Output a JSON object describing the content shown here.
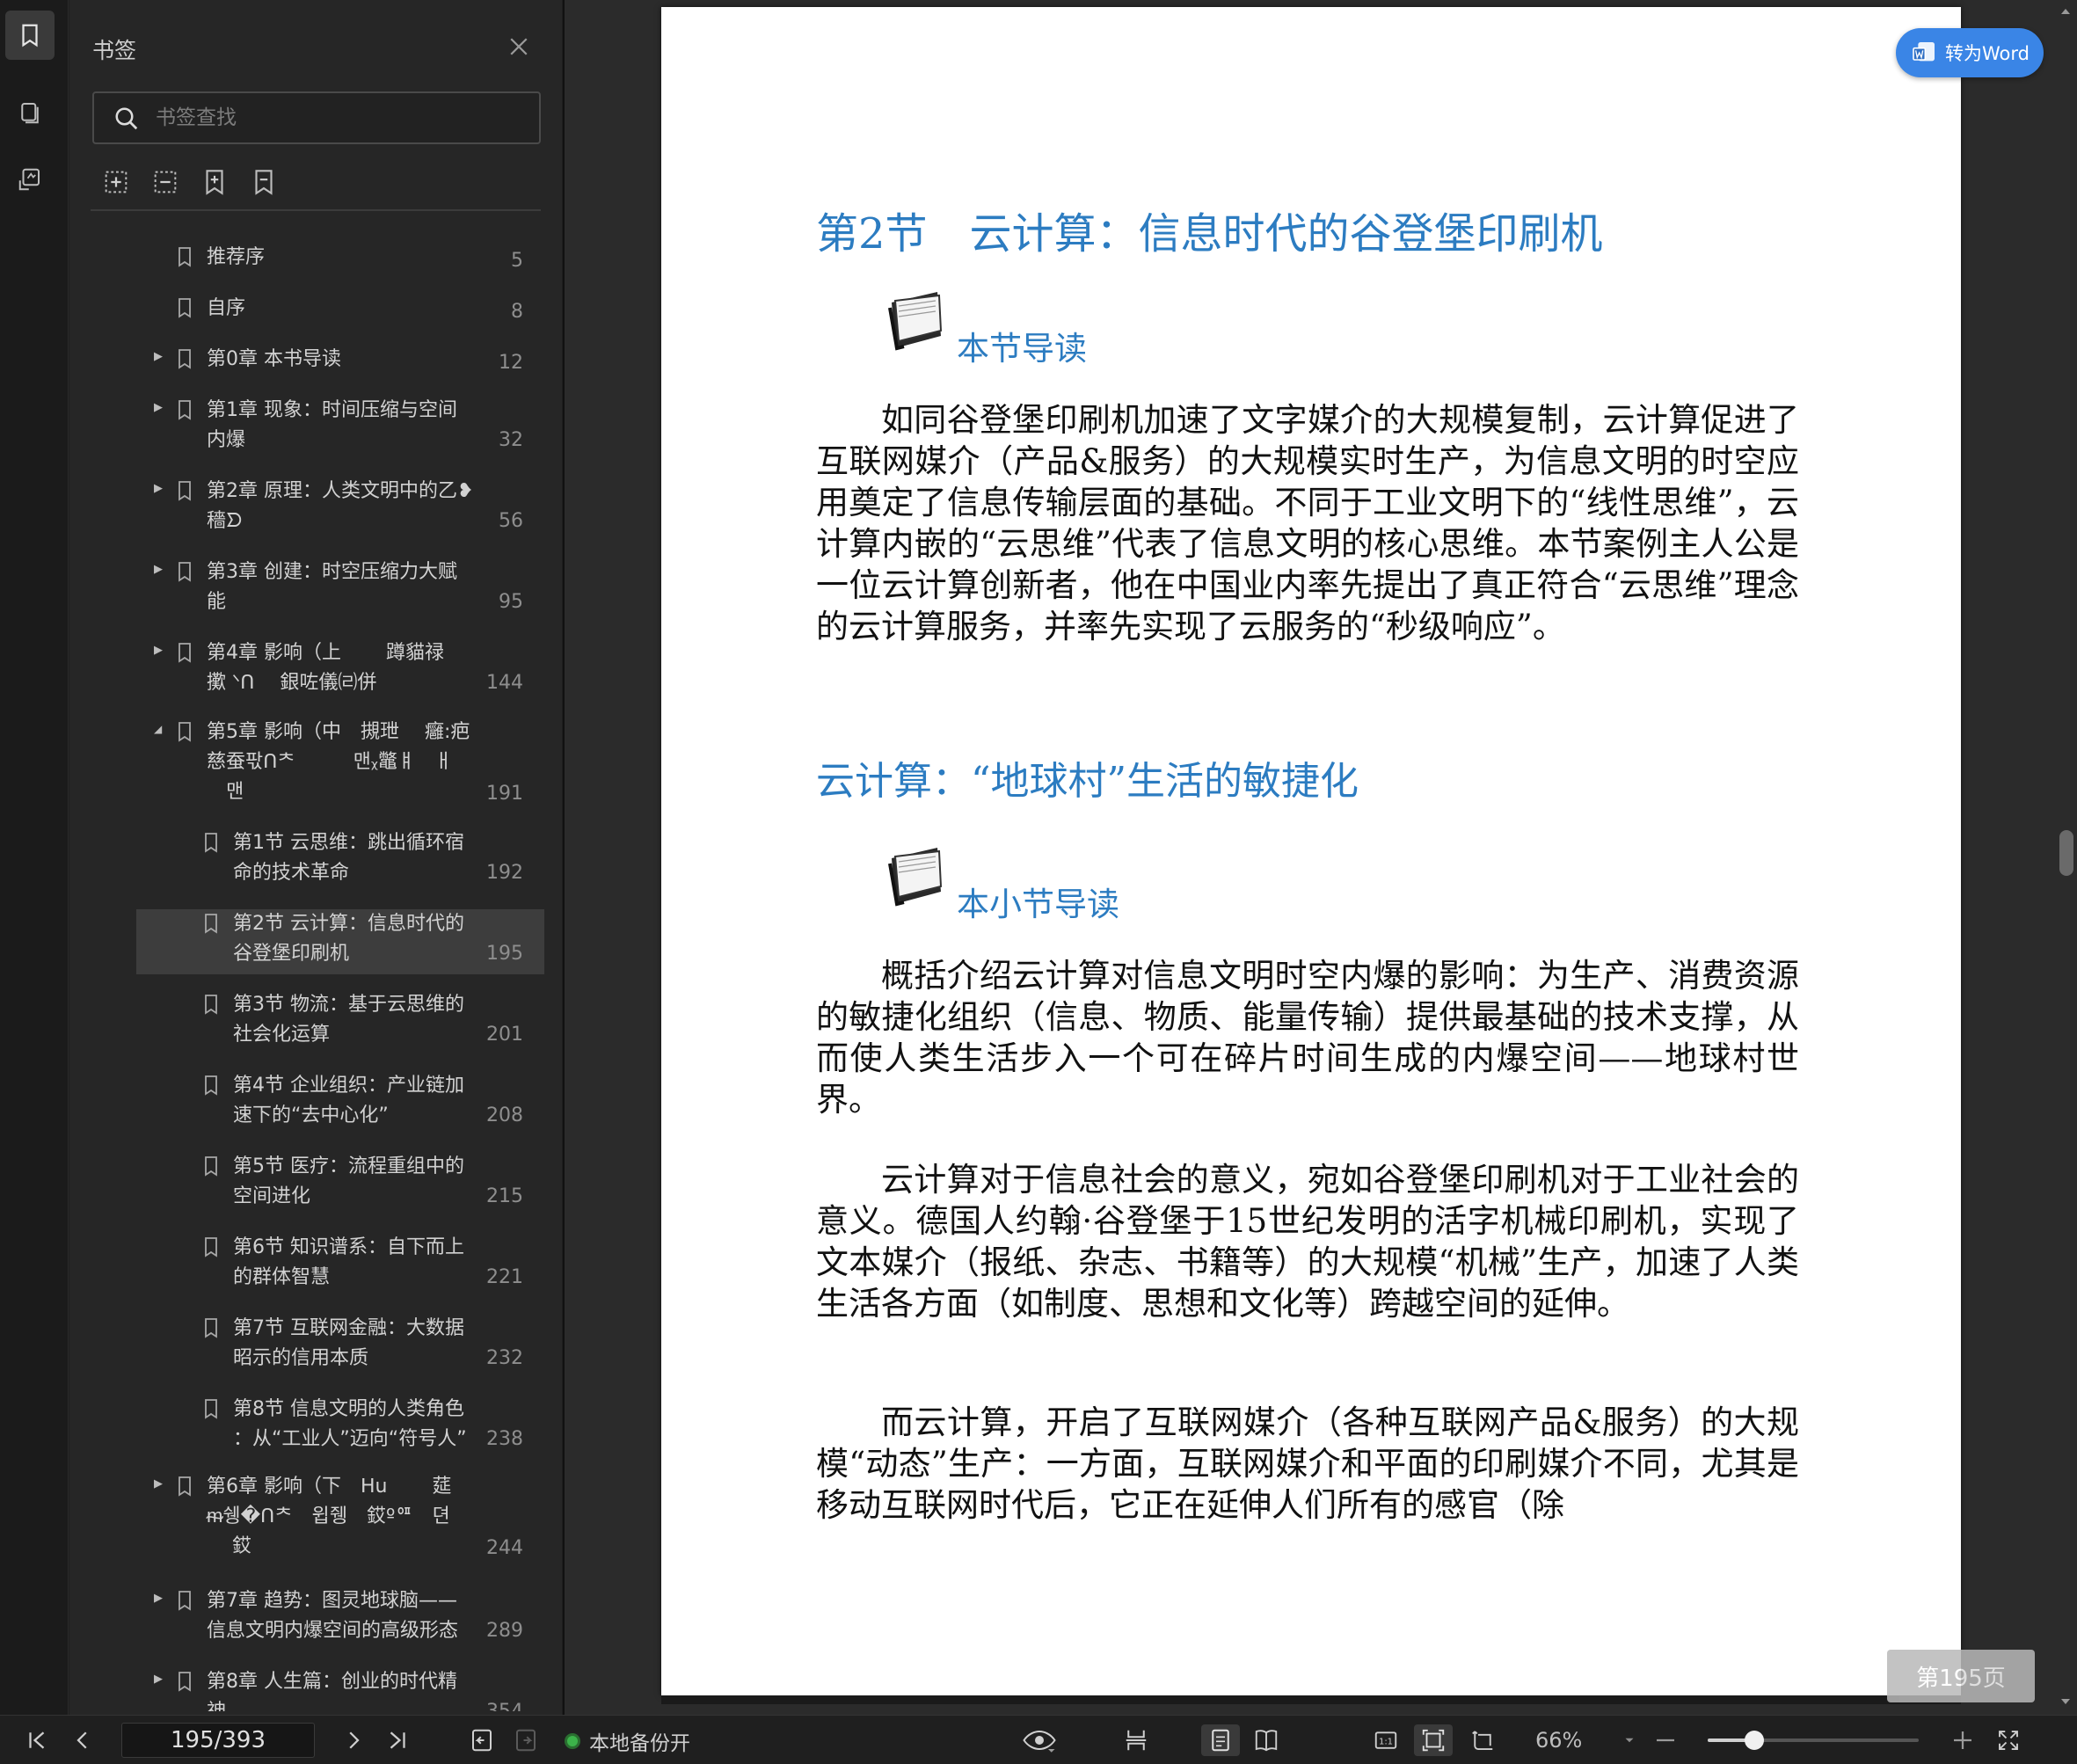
{
  "sidebar": {
    "title": "书签",
    "search_placeholder": "书签查找",
    "items": [
      {
        "label": "推荐序",
        "page": "5"
      },
      {
        "label": "自序",
        "page": "8"
      },
      {
        "label": "第0章 本书导读",
        "page": "12"
      },
      {
        "label": "第1章 现象：时间压缩与空间\n内爆",
        "page": "32"
      },
      {
        "label": "第2章 原理：人类文明中的乙❥\n  穡ᗤ",
        "page": "56"
      },
      {
        "label": "第3章 创建：时空压缩力大赋\n能",
        "page": "95"
      },
      {
        "label": "第4章 影响（上　　 蹲貓禄\n擹 ᐠᑎ　 銀咗儀㈃併",
        "page": "144"
      },
      {
        "label": "第5章 影响（中　摫玴　 癰:疤\n慈蚕팏ᑎᄎ　　　맨ᵪ鼈ㅒ　ㅐ\n　맨",
        "page": "191"
      },
      {
        "label": "第1节 云思维：跳出循环宿\n命的技术革命",
        "page": "192"
      },
      {
        "label": "第2节 云计算：信息时代的\n谷登堡印刷机",
        "page": "195"
      },
      {
        "label": "第3节 物流：基于云思维的\n社会化运算",
        "page": "201"
      },
      {
        "label": "第4节 企业组织：产业链加\n速下的“去中心化”",
        "page": "208"
      },
      {
        "label": "第5节 医疗：流程重组中的\n空间进化",
        "page": "215"
      },
      {
        "label": "第6节 知识谱系：自下而上\n的群体智慧",
        "page": "221"
      },
      {
        "label": "第7节 互联网金融：大数据\n昭示的信用本质",
        "page": "232"
      },
      {
        "label": "第8节 信息文明的人类角色\n：从“工业人”迈向“符号人”",
        "page": "238"
      },
      {
        "label": "第6章 影响（下　ᕼu　　 莚\n  ᵯ쉥�ᑎᄎ　윕쥉　銰ºᅋ　뎐\n　 銰",
        "page": "244"
      },
      {
        "label": "第7章 趋势：图灵地球脑——\n信息文明内爆空间的高级形态",
        "page": "289"
      },
      {
        "label": "第8章 人生篇：创业的时代精\n神",
        "page": "354"
      }
    ]
  },
  "document": {
    "section_title": "第2节　云计算：信息时代的谷登堡印刷机",
    "guide1": "本节导读",
    "para1": "如同谷登堡印刷机加速了文字媒介的大规模复制，云计算促进了互联网媒介（产品&服务）的大规模实时生产，为信息文明的时空应用奠定了信息传输层面的基础。不同于工业文明下的“线性思维”，云计算内嵌的“云思维”代表了信息文明的核心思维。本节案例主人公是一位云计算创新者，他在中国业内率先提出了真正符合“云思维”理念的云计算服务，并率先实现了云服务的“秒级响应”。",
    "subheading": "云计算：“地球村”生活的敏捷化",
    "guide2": "本小节导读",
    "para2": "概括介绍云计算对信息文明时空内爆的影响：为生产、消费资源的敏捷化组织（信息、物质、能量传输）提供最基础的技术支撑，从而使人类生活步入一个可在碎片时间生成的内爆空间——地球村世界。",
    "para3": "云计算对于信息社会的意义，宛如谷登堡印刷机对于工业社会的意义。德国人约翰·谷登堡于15世纪发明的活字机械印刷机，实现了文本媒介（报纸、杂志、书籍等）的大规模“机械”生产，加速了人类生活各方面（如制度、思想和文化等）跨越空间的延伸。",
    "para4": "而云计算，开启了互联网媒介（各种互联网产品&服务）的大规模“动态”生产：一方面，互联网媒介和平面的印刷媒介不同，尤其是移动互联网时代后，它正在延伸人们所有的感官（除",
    "to_word_label": "转为Word",
    "page_badge": "第195页"
  },
  "statusbar": {
    "page_indicator": "195/393",
    "backup_label": "本地备份开",
    "zoom": "66%",
    "zoom_level": 0.22
  },
  "colors": {
    "accent": "#2c7cc1",
    "word_button": "#3a85e6",
    "backup_on": "#3cb34a"
  }
}
